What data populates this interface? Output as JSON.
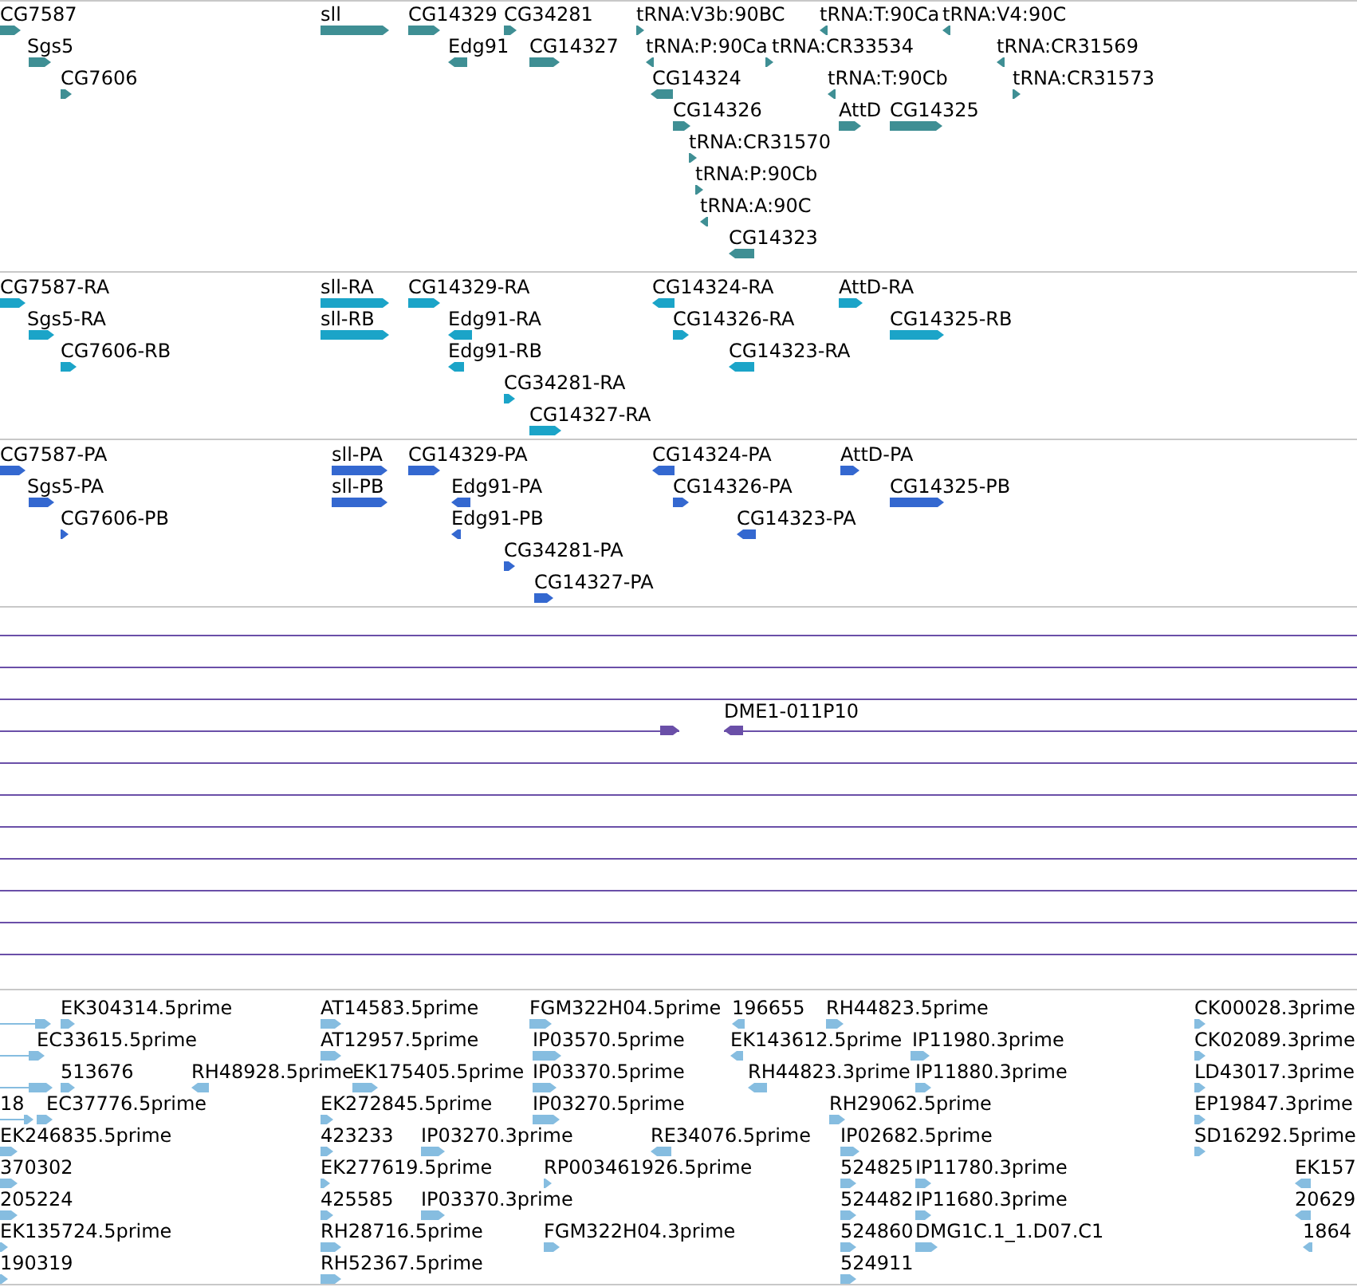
{
  "tracks": [
    {
      "kind": "genes",
      "features": [
        {
          "kind": "feature",
          "label": "CG7587",
          "reverse": false
        },
        {
          "kind": "feature",
          "label": "Sgs5",
          "reverse": false
        },
        {
          "kind": "feature",
          "label": "CG7606",
          "reverse": false
        },
        {
          "kind": "feature",
          "label": "sll",
          "reverse": false
        },
        {
          "kind": "feature",
          "label": "CG14329",
          "reverse": false
        },
        {
          "kind": "feature",
          "label": "CG34281",
          "reverse": false
        },
        {
          "kind": "feature",
          "label": "Edg91",
          "reverse": true
        },
        {
          "kind": "feature",
          "label": "CG14327",
          "reverse": false
        },
        {
          "kind": "feature",
          "label": "tRNA:V3b:90BC",
          "reverse": false
        },
        {
          "kind": "feature",
          "label": "tRNA:T:90Ca",
          "reverse": true
        },
        {
          "kind": "feature",
          "label": "tRNA:V4:90C",
          "reverse": true
        },
        {
          "kind": "feature",
          "label": "tRNA:P:90Ca",
          "reverse": true
        },
        {
          "kind": "feature",
          "label": "tRNA:CR33534",
          "reverse": false
        },
        {
          "kind": "feature",
          "label": "tRNA:CR31569",
          "reverse": true
        },
        {
          "kind": "feature",
          "label": "CG14324",
          "reverse": true
        },
        {
          "kind": "feature",
          "label": "tRNA:T:90Cb",
          "reverse": true
        },
        {
          "kind": "feature",
          "label": "tRNA:CR31573",
          "reverse": false
        },
        {
          "kind": "feature",
          "label": "CG14326",
          "reverse": false
        },
        {
          "kind": "feature",
          "label": "AttD",
          "reverse": false
        },
        {
          "kind": "feature",
          "label": "CG14325",
          "reverse": false
        },
        {
          "kind": "feature",
          "label": "tRNA:CR31570",
          "reverse": false
        },
        {
          "kind": "feature",
          "label": "tRNA:P:90Cb",
          "reverse": false
        },
        {
          "kind": "feature",
          "label": "tRNA:A:90C",
          "reverse": true
        },
        {
          "kind": "feature",
          "label": "CG14323",
          "reverse": true
        }
      ]
    },
    {
      "kind": "transcripts",
      "features": [
        {
          "kind": "feature",
          "label": "CG7587-RA",
          "reverse": false
        },
        {
          "kind": "feature",
          "label": "Sgs5-RA",
          "reverse": false
        },
        {
          "kind": "feature",
          "label": "CG7606-RB",
          "reverse": false
        },
        {
          "kind": "feature",
          "label": "sll-RA",
          "reverse": false
        },
        {
          "kind": "feature",
          "label": "sll-RB",
          "reverse": false
        },
        {
          "kind": "feature",
          "label": "CG14329-RA",
          "reverse": false
        },
        {
          "kind": "feature",
          "label": "Edg91-RA",
          "reverse": true
        },
        {
          "kind": "feature",
          "label": "Edg91-RB",
          "reverse": true
        },
        {
          "kind": "feature",
          "label": "CG34281-RA",
          "reverse": false
        },
        {
          "kind": "feature",
          "label": "CG14327-RA",
          "reverse": false
        },
        {
          "kind": "feature",
          "label": "CG14324-RA",
          "reverse": true
        },
        {
          "kind": "feature",
          "label": "CG14326-RA",
          "reverse": false
        },
        {
          "kind": "feature",
          "label": "CG14323-RA",
          "reverse": true
        },
        {
          "kind": "feature",
          "label": "AttD-RA",
          "reverse": false
        },
        {
          "kind": "feature",
          "label": "CG14325-RB",
          "reverse": false
        }
      ]
    },
    {
      "kind": "proteins",
      "features": [
        {
          "kind": "feature",
          "label": "CG7587-PA",
          "reverse": false
        },
        {
          "kind": "feature",
          "label": "Sgs5-PA",
          "reverse": false
        },
        {
          "kind": "feature",
          "label": "CG7606-PB",
          "reverse": false
        },
        {
          "kind": "feature",
          "label": "sll-PA",
          "reverse": false
        },
        {
          "kind": "feature",
          "label": "sll-PB",
          "reverse": false
        },
        {
          "kind": "feature",
          "label": "CG14329-PA",
          "reverse": false
        },
        {
          "kind": "feature",
          "label": "Edg91-PA",
          "reverse": true
        },
        {
          "kind": "feature",
          "label": "Edg91-PB",
          "reverse": true
        },
        {
          "kind": "feature",
          "label": "CG34281-PA",
          "reverse": false
        },
        {
          "kind": "feature",
          "label": "CG14327-PA",
          "reverse": false
        },
        {
          "kind": "feature",
          "label": "CG14324-PA",
          "reverse": true
        },
        {
          "kind": "feature",
          "label": "CG14326-PA",
          "reverse": false
        },
        {
          "kind": "feature",
          "label": "CG14323-PA",
          "reverse": true
        },
        {
          "kind": "feature",
          "label": "AttD-PA",
          "reverse": false
        },
        {
          "kind": "feature",
          "label": "CG14325-PB",
          "reverse": false
        }
      ]
    },
    {
      "kind": "clones",
      "features": [
        {
          "kind": "span"
        },
        {
          "kind": "span"
        },
        {
          "kind": "span"
        },
        {
          "kind": "pair",
          "label": "DME1-011P10"
        },
        {
          "kind": "span"
        },
        {
          "kind": "span"
        },
        {
          "kind": "span"
        },
        {
          "kind": "span"
        },
        {
          "kind": "span"
        },
        {
          "kind": "span"
        },
        {
          "kind": "span"
        }
      ]
    },
    {
      "kind": "ests",
      "features": [
        {
          "kind": "clipped",
          "reverse": false
        },
        {
          "kind": "feature",
          "label": "EK304314.5prime",
          "reverse": false
        },
        {
          "kind": "feature",
          "label": "AT14583.5prime",
          "reverse": false
        },
        {
          "kind": "feature",
          "label": "FGM322H04.5prime",
          "reverse": false
        },
        {
          "kind": "feature",
          "label": "196655",
          "reverse": true
        },
        {
          "kind": "feature",
          "label": "RH44823.5prime",
          "reverse": false
        },
        {
          "kind": "feature",
          "label": "CK00028.3prime",
          "reverse": false
        },
        {
          "kind": "feature",
          "label": "EC33615.5prime",
          "reverse": false
        },
        {
          "kind": "feature",
          "label": "AT12957.5prime",
          "reverse": false
        },
        {
          "kind": "feature",
          "label": "IP03570.5prime",
          "reverse": false
        },
        {
          "kind": "feature",
          "label": "EK143612.5prime",
          "reverse": true
        },
        {
          "kind": "feature",
          "label": "IP11980.3prime",
          "reverse": false
        },
        {
          "kind": "feature",
          "label": "CK02089.3prime",
          "reverse": false
        },
        {
          "kind": "clipped",
          "reverse": false
        },
        {
          "kind": "feature",
          "label": "513676",
          "reverse": false
        },
        {
          "kind": "feature",
          "label": "RH48928.5prime",
          "reverse": true
        },
        {
          "kind": "feature",
          "label": "EK175405.5prime",
          "reverse": false
        },
        {
          "kind": "feature",
          "label": "IP03370.5prime",
          "reverse": false
        },
        {
          "kind": "feature",
          "label": "RH44823.3prime",
          "reverse": true
        },
        {
          "kind": "feature",
          "label": "IP11880.3prime",
          "reverse": false
        },
        {
          "kind": "feature",
          "label": "LD43017.3prime",
          "reverse": false
        },
        {
          "kind": "feature",
          "label": "18",
          "reverse": false
        },
        {
          "kind": "feature",
          "label": "EC37776.5prime",
          "reverse": false
        },
        {
          "kind": "feature",
          "label": "EK272845.5prime",
          "reverse": false
        },
        {
          "kind": "feature",
          "label": "IP03270.5prime",
          "reverse": false
        },
        {
          "kind": "feature",
          "label": "RH29062.5prime",
          "reverse": false
        },
        {
          "kind": "feature",
          "label": "EP19847.3prime",
          "reverse": false
        },
        {
          "kind": "feature",
          "label": "EK246835.5prime",
          "reverse": false
        },
        {
          "kind": "feature",
          "label": "423233",
          "reverse": false
        },
        {
          "kind": "feature",
          "label": "IP03270.3prime",
          "reverse": false
        },
        {
          "kind": "feature",
          "label": "RE34076.5prime",
          "reverse": true
        },
        {
          "kind": "feature",
          "label": "IP02682.5prime",
          "reverse": false
        },
        {
          "kind": "feature",
          "label": "SD16292.5prime",
          "reverse": false
        },
        {
          "kind": "feature",
          "label": "370302",
          "reverse": false
        },
        {
          "kind": "feature",
          "label": "EK277619.5prime",
          "reverse": false
        },
        {
          "kind": "feature",
          "label": "RP003461926.5prime",
          "reverse": false
        },
        {
          "kind": "feature",
          "label": "524825",
          "reverse": false
        },
        {
          "kind": "feature",
          "label": "IP11780.3prime",
          "reverse": false
        },
        {
          "kind": "feature",
          "label": "EK157",
          "reverse": true
        },
        {
          "kind": "feature",
          "label": "205224",
          "reverse": false
        },
        {
          "kind": "feature",
          "label": "425585",
          "reverse": false
        },
        {
          "kind": "feature",
          "label": "IP03370.3prime",
          "reverse": false
        },
        {
          "kind": "feature",
          "label": "524482",
          "reverse": false
        },
        {
          "kind": "feature",
          "label": "IP11680.3prime",
          "reverse": false
        },
        {
          "kind": "feature",
          "label": "20629",
          "reverse": true
        },
        {
          "kind": "feature",
          "label": "EK135724.5prime",
          "reverse": false
        },
        {
          "kind": "feature",
          "label": "RH28716.5prime",
          "reverse": false
        },
        {
          "kind": "feature",
          "label": "FGM322H04.3prime",
          "reverse": false
        },
        {
          "kind": "feature",
          "label": "524860",
          "reverse": false
        },
        {
          "kind": "feature",
          "label": "DMG1C.1_1.D07.C1",
          "reverse": false
        },
        {
          "kind": "feature",
          "label": "1864",
          "reverse": true
        },
        {
          "kind": "feature",
          "label": "190319",
          "reverse": false
        },
        {
          "kind": "feature",
          "label": "RH52367.5prime",
          "reverse": false
        },
        {
          "kind": "feature",
          "label": "524911",
          "reverse": false
        }
      ]
    }
  ]
}
